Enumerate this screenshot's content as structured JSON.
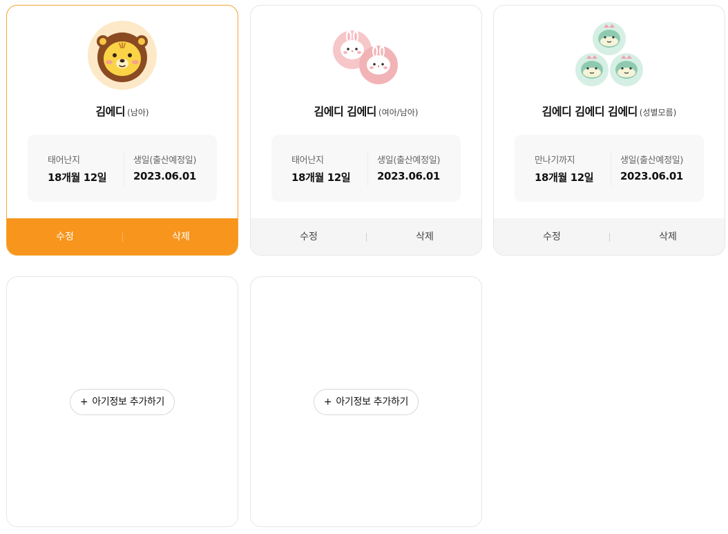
{
  "babies": [
    {
      "name": "김에디",
      "gender": "(남아)",
      "info_left_label": "태어난지",
      "info_left_value": "18개월 12일",
      "info_right_label": "생일(출산예정일)",
      "info_right_value": "2023.06.01",
      "edit_label": "수정",
      "delete_label": "삭제",
      "avatar_icon": "lion-avatar-icon",
      "selected": true
    },
    {
      "name": "김에디 김에디",
      "gender": "(여아/남아)",
      "info_left_label": "태어난지",
      "info_left_value": "18개월 12일",
      "info_right_label": "생일(출산예정일)",
      "info_right_value": "2023.06.01",
      "edit_label": "수정",
      "delete_label": "삭제",
      "avatar_icon": "rabbit-twins-avatar-icon",
      "selected": false
    },
    {
      "name": "김에디 김에디 김에디",
      "gender": "(성별모름)",
      "info_left_label": "만나기까지",
      "info_left_value": "18개월 12일",
      "info_right_label": "생일(출산예정일)",
      "info_right_value": "2023.06.01",
      "edit_label": "수정",
      "delete_label": "삭제",
      "avatar_icon": "dinosaur-triplets-avatar-icon",
      "selected": false
    }
  ],
  "add_slots": [
    {
      "label": "아기정보 추가하기",
      "icon": "plus-icon"
    },
    {
      "label": "아기정보 추가하기",
      "icon": "plus-icon"
    }
  ],
  "colors": {
    "accent": "#f7951d",
    "selected_border": "#f0a531",
    "info_bg": "#f8f8f8",
    "action_bg": "#f5f5f5"
  }
}
